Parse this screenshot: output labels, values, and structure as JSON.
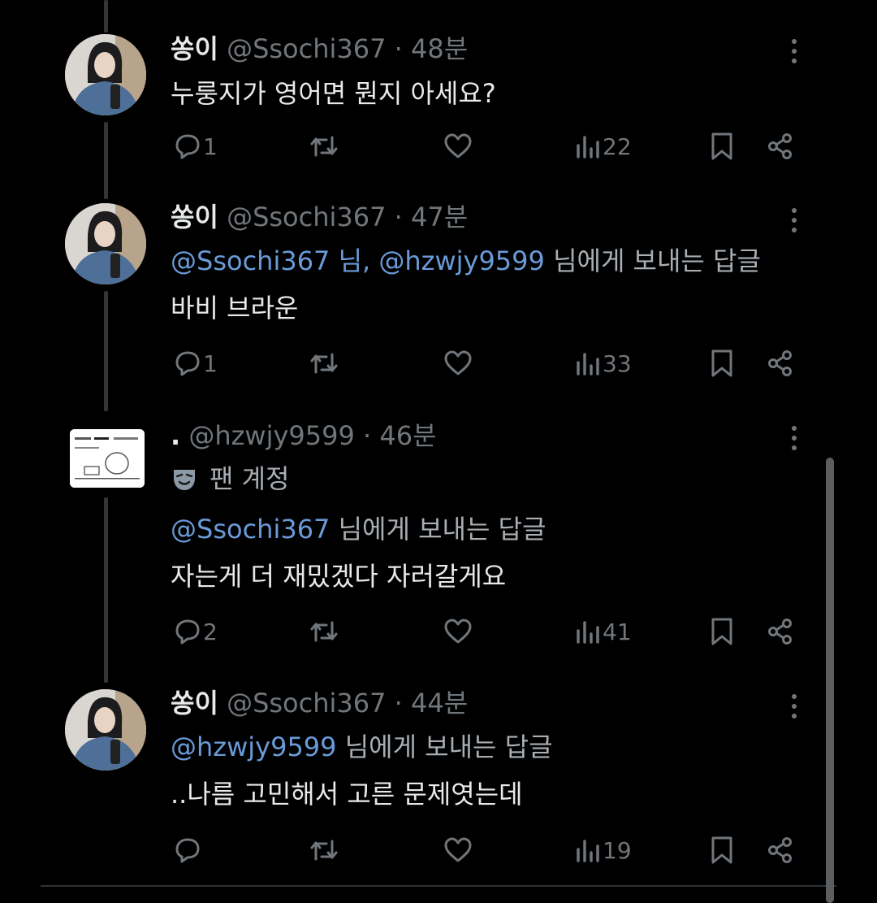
{
  "tweets": [
    {
      "name": "쏭이",
      "handle": "@Ssochi367",
      "time": "· 48분",
      "lines": [
        "누룽지가 영어면 뭔지 아세요?"
      ],
      "stats": {
        "replies": "1",
        "retweets": "",
        "likes": "",
        "views": "22"
      }
    },
    {
      "name": "쏭이",
      "handle": "@Ssochi367",
      "time": "· 47분",
      "reply_mentions": "@Ssochi367 님, @hzwjy9599",
      "reply_suffix": "님에게 보내는 답글",
      "lines": [
        "바비 브라운"
      ],
      "stats": {
        "replies": "1",
        "retweets": "",
        "likes": "",
        "views": "33"
      }
    },
    {
      "name": ".",
      "handle": "@hzwjy9599",
      "time": "· 46분",
      "badge_label": "팬 계정",
      "reply_mentions": "@Ssochi367",
      "reply_suffix": "님에게 보내는 답글",
      "lines": [
        "자는게 더 재밌겠다 자러갈게요"
      ],
      "stats": {
        "replies": "2",
        "retweets": "",
        "likes": "",
        "views": "41"
      }
    },
    {
      "name": "쏭이",
      "handle": "@Ssochi367",
      "time": "· 44분",
      "reply_mentions": "@hzwjy9599",
      "reply_suffix": "님에게 보내는 답글",
      "lines": [
        "..나름 고민해서 고른 문제엿는데"
      ],
      "stats": {
        "replies": "",
        "retweets": "",
        "likes": "",
        "views": "19"
      }
    }
  ],
  "icons": {
    "reply": "speech-bubble-icon",
    "retweet": "retweet-icon",
    "like": "heart-icon",
    "views": "bar-chart-icon",
    "bookmark": "bookmark-icon",
    "share": "share-icon",
    "more": "more-vertical-icon",
    "badge": "theater-mask-icon"
  },
  "colors": {
    "background": "#000000",
    "text": "#e7e9ea",
    "muted": "#71767b",
    "mention": "#6a9bd8"
  }
}
